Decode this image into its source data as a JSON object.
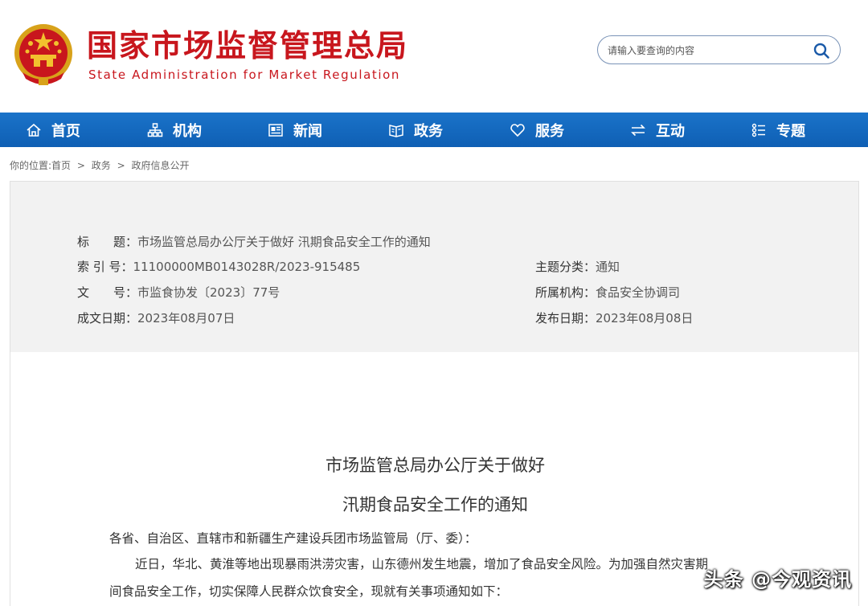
{
  "header": {
    "title_cn": "国家市场监督管理总局",
    "title_en": "State Administration for Market Regulation",
    "search_placeholder": "请输入要查询的内容"
  },
  "nav": {
    "items": [
      {
        "label": "首页",
        "icon": "home-icon"
      },
      {
        "label": "机构",
        "icon": "org-icon"
      },
      {
        "label": "新闻",
        "icon": "news-icon"
      },
      {
        "label": "政务",
        "icon": "gov-icon"
      },
      {
        "label": "服务",
        "icon": "heart-icon"
      },
      {
        "label": "互动",
        "icon": "exchange-icon"
      },
      {
        "label": "专题",
        "icon": "topic-icon"
      }
    ]
  },
  "breadcrumb": {
    "prefix": "你的位置:",
    "items": [
      "首页",
      ">",
      "政务",
      ">",
      "政府信息公开"
    ]
  },
  "meta": {
    "title_label": "标　　题：",
    "title_value": "市场监管总局办公厅关于做好 汛期食品安全工作的通知",
    "index_label": "索 引 号：",
    "index_value": "11100000MB0143028R/2023-915485",
    "topic_label": "主题分类：",
    "topic_value": "通知",
    "docno_label": "文　　号：",
    "docno_value": "市监食协发〔2023〕77号",
    "org_label": "所属机构：",
    "org_value": "食品安全协调司",
    "created_label": "成文日期：",
    "created_value": "2023年08月07日",
    "published_label": "发布日期：",
    "published_value": "2023年08月08日"
  },
  "article": {
    "title_line1": "市场监管总局办公厅关于做好",
    "title_line2": "汛期食品安全工作的通知",
    "salutation": "各省、自治区、直辖市和新疆生产建设兵团市场监管局（厅、委）：",
    "para1_line1": "近日，华北、黄淮等地出现暴雨洪涝灾害，山东德州发生地震，增加了食品安全风险。为加强自然灾害期",
    "para1_line2": "间食品安全工作，切实保障人民群众饮食安全，现就有关事项通知如下："
  },
  "watermark": "头条 @今观资讯",
  "colors": {
    "brand_red": "#c8161d",
    "nav_blue": "#1467bf"
  }
}
